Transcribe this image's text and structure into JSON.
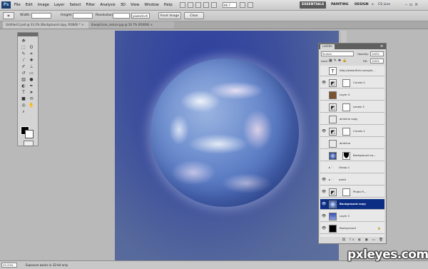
{
  "app": {
    "logo": "Ps",
    "menus": [
      "File",
      "Edit",
      "Image",
      "Layer",
      "Select",
      "Filter",
      "Analysis",
      "3D",
      "View",
      "Window",
      "Help"
    ],
    "zoom": "66.7",
    "workspaces": [
      "ESSENTIALS",
      "PAINTING",
      "DESIGN",
      "»"
    ],
    "cs_live": "CS Live",
    "window_controls": "–▫×"
  },
  "options_bar": {
    "tool_icon": "crop-icon",
    "width_label": "Width:",
    "height_label": "Height:",
    "resolution_label": "Resolution:",
    "resolution_unit": "pixels/inch",
    "front_image": "Front Image",
    "clear": "Clear"
  },
  "tabs": [
    {
      "label": "Untitled-2.psd @ 33.3% (Background copy, RGB/8) * ×"
    },
    {
      "label": "bluepicture_nature.jpg @ 16.7% (RGB/8) ×"
    }
  ],
  "layers_panel": {
    "tab": "LAYERS",
    "blend_mode": "Screen",
    "opacity_label": "Opacity:",
    "opacity": "100%",
    "lock_label": "Lock:",
    "fill_label": "Fill:",
    "fill": "100%",
    "layers": [
      {
        "name": "http://www.flickr.com/ph...",
        "visible": false,
        "kind": "text",
        "selected": false
      },
      {
        "name": "Curves 2",
        "visible": true,
        "kind": "adjust",
        "selected": false
      },
      {
        "name": "Layer 4",
        "visible": false,
        "kind": "brown",
        "selected": false
      },
      {
        "name": "Levels 3",
        "visible": false,
        "kind": "adjust",
        "selected": false
      },
      {
        "name": "airshine copy",
        "visible": false,
        "kind": "pattern",
        "selected": false
      },
      {
        "name": "Curves 1",
        "visible": true,
        "kind": "adjust",
        "selected": false
      },
      {
        "name": "airshine",
        "visible": false,
        "kind": "pattern",
        "selected": false
      },
      {
        "name": "Background co...",
        "visible": false,
        "kind": "earth-mask",
        "selected": false
      },
      {
        "name": "Group 1",
        "visible": false,
        "kind": "group",
        "selected": false
      },
      {
        "name": "earth",
        "visible": true,
        "kind": "group",
        "selected": false
      },
      {
        "name": "Photo Fi...",
        "visible": true,
        "kind": "adjust",
        "selected": false
      },
      {
        "name": "Background copy",
        "visible": true,
        "kind": "earth",
        "selected": true
      },
      {
        "name": "Layer 2",
        "visible": true,
        "kind": "blue",
        "selected": false
      },
      {
        "name": "Background",
        "visible": true,
        "kind": "black",
        "selected": false
      }
    ]
  },
  "status": {
    "zoom": "33.33%",
    "message": "Exposure works in 32-bit only"
  },
  "watermark": "pxleyes.com"
}
